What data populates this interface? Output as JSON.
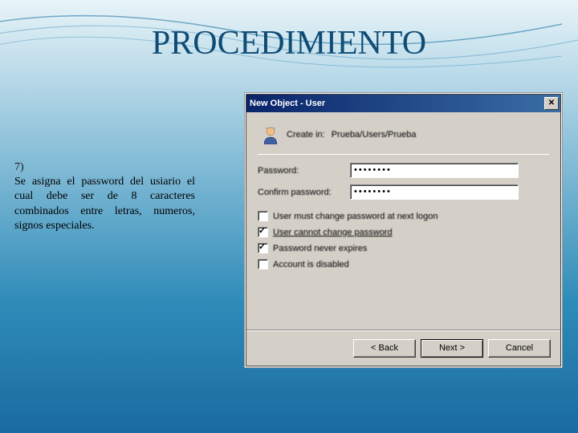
{
  "slide": {
    "title": "PROCEDIMIENTO",
    "step_number": "7)",
    "step_text": "Se asigna el password del usiario el cual debe ser de 8 caracteres combinados entre letras, numeros, signos especiales."
  },
  "dialog": {
    "title": "New Object - User",
    "create_in_label": "Create in:",
    "create_in_path": "Prueba/Users/Prueba",
    "password_label": "Password:",
    "password_value": "••••••••",
    "confirm_label": "Confirm password:",
    "confirm_value": "••••••••",
    "checkboxes": {
      "change_next_logon": {
        "label": "User must change password at next logon",
        "checked": false,
        "disabled": false
      },
      "cannot_change": {
        "label": "User cannot change password",
        "checked": true,
        "disabled": false
      },
      "never_expires": {
        "label": "Password never expires",
        "checked": true,
        "disabled": false
      },
      "disabled": {
        "label": "Account is disabled",
        "checked": false,
        "disabled": false
      }
    },
    "buttons": {
      "back": "< Back",
      "next": "Next >",
      "cancel": "Cancel"
    }
  }
}
